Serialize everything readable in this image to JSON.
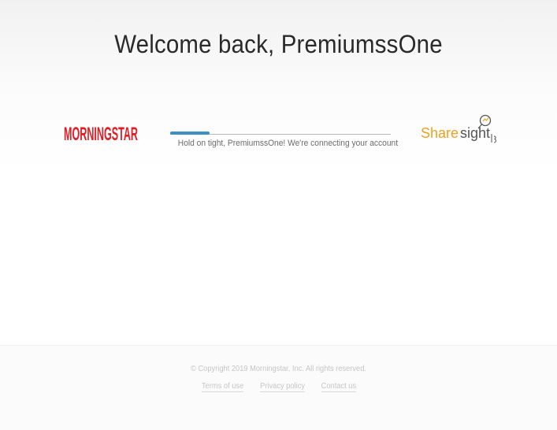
{
  "header": {
    "welcome_text": "Welcome back, PremiumssOne"
  },
  "connection": {
    "left_logo": {
      "name": "morningstar-logo",
      "text": "MORNINGSTAR",
      "color": "#e31b23"
    },
    "right_logo": {
      "name": "sharesight-logo",
      "text_share": "Share",
      "text_sight": "sight",
      "color_share": "#f0a020",
      "color_sight": "#555555"
    },
    "progress_fraction": 0.18,
    "progress_color": "#3d8fc4",
    "status_text": "Hold on tight, PremiumssOne! We're connecting your account"
  },
  "footer": {
    "copyright": "© Copyright 2019 Morningstar, Inc. All rights reserved.",
    "links": {
      "terms": "Terms of use",
      "privacy": "Privacy policy",
      "contact": "Contact us"
    }
  }
}
